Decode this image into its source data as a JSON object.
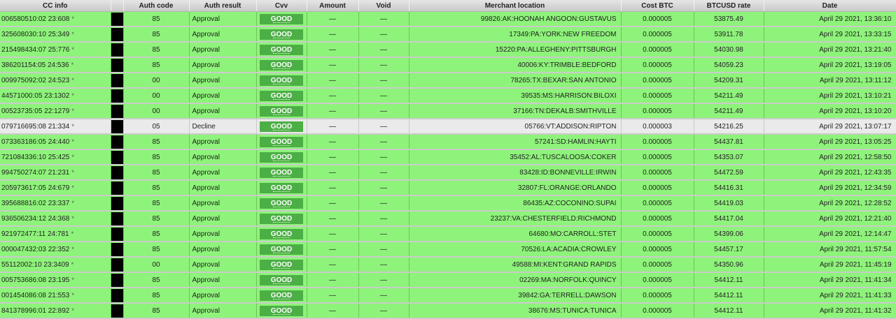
{
  "headers": {
    "cc_info": "CC info",
    "auth_code": "Auth code",
    "auth_result": "Auth result",
    "cvv": "Cvv",
    "amount": "Amount",
    "void": "Void",
    "merchant_location": "Merchant location",
    "cost_btc": "Cost BTC",
    "btcusd_rate": "BTCUSD rate",
    "date": "Date"
  },
  "colors": {
    "approval_row": "#8ef37a",
    "decline_row": "#e9eae9",
    "good_badge": "#4caf45",
    "swatch": "#000000"
  },
  "rows": [
    {
      "cc": "006580510:02 23:608",
      "star": "*",
      "auth_code": "85",
      "auth_result": "Approval",
      "cvv": "GOOD",
      "amount": "—",
      "void": "—",
      "location": "99826:AK:HOONAH ANGOON:GUSTAVUS",
      "cost_btc": "0.000005",
      "rate": "53875.49",
      "date": "April 29 2021, 13:36:10"
    },
    {
      "cc": "325608030:10 25:349",
      "star": "*",
      "auth_code": "85",
      "auth_result": "Approval",
      "cvv": "GOOD",
      "amount": "—",
      "void": "—",
      "location": "17349:PA:YORK:NEW FREEDOM",
      "cost_btc": "0.000005",
      "rate": "53911.78",
      "date": "April 29 2021, 13:33:15"
    },
    {
      "cc": "215498434:07 25:776",
      "star": "*",
      "auth_code": "85",
      "auth_result": "Approval",
      "cvv": "GOOD",
      "amount": "—",
      "void": "—",
      "location": "15220:PA:ALLEGHENY:PITTSBURGH",
      "cost_btc": "0.000005",
      "rate": "54030.98",
      "date": "April 29 2021, 13:21:40"
    },
    {
      "cc": "386201154:05 24:536",
      "star": "*",
      "auth_code": "85",
      "auth_result": "Approval",
      "cvv": "GOOD",
      "amount": "—",
      "void": "—",
      "location": "40006:KY:TRIMBLE:BEDFORD",
      "cost_btc": "0.000005",
      "rate": "54059.23",
      "date": "April 29 2021, 13:19:05"
    },
    {
      "cc": "009975092:02 24:523",
      "star": "*",
      "auth_code": "00",
      "auth_result": "Approval",
      "cvv": "GOOD",
      "amount": "—",
      "void": "—",
      "location": "78265:TX:BEXAR:SAN ANTONIO",
      "cost_btc": "0.000005",
      "rate": "54209.31",
      "date": "April 29 2021, 13:11:12"
    },
    {
      "cc": "44571000:05 23:1302",
      "star": "*",
      "auth_code": "00",
      "auth_result": "Approval",
      "cvv": "GOOD",
      "amount": "—",
      "void": "—",
      "location": "39535:MS:HARRISON:BILOXI",
      "cost_btc": "0.000005",
      "rate": "54211.49",
      "date": "April 29 2021, 13:10:21"
    },
    {
      "cc": "00523735:05 22:1279",
      "star": "*",
      "auth_code": "00",
      "auth_result": "Approval",
      "cvv": "GOOD",
      "amount": "—",
      "void": "—",
      "location": "37166:TN:DEKALB:SMITHVILLE",
      "cost_btc": "0.000005",
      "rate": "54211.49",
      "date": "April 29 2021, 13:10:20"
    },
    {
      "cc": "079716695:08 21:334",
      "star": "*",
      "auth_code": "05",
      "auth_result": "Decline",
      "cvv": "GOOD",
      "amount": "—",
      "void": "—",
      "location": "05766:VT:ADDISON:RIPTON",
      "cost_btc": "0.000003",
      "rate": "54216.25",
      "date": "April 29 2021, 13:07:17"
    },
    {
      "cc": "073363186:05 24:440",
      "star": "*",
      "auth_code": "85",
      "auth_result": "Approval",
      "cvv": "GOOD",
      "amount": "—",
      "void": "—",
      "location": "57241:SD:HAMLIN:HAYTI",
      "cost_btc": "0.000005",
      "rate": "54437.81",
      "date": "April 29 2021, 13:05:25"
    },
    {
      "cc": "721084336:10 25:425",
      "star": "*",
      "auth_code": "85",
      "auth_result": "Approval",
      "cvv": "GOOD",
      "amount": "—",
      "void": "—",
      "location": "35452:AL:TUSCALOOSA:COKER",
      "cost_btc": "0.000005",
      "rate": "54353.07",
      "date": "April 29 2021, 12:58:50"
    },
    {
      "cc": "994750274:07 21:231",
      "star": "*",
      "auth_code": "85",
      "auth_result": "Approval",
      "cvv": "GOOD",
      "amount": "—",
      "void": "—",
      "location": "83428:ID:BONNEVILLE:IRWIN",
      "cost_btc": "0.000005",
      "rate": "54472.59",
      "date": "April 29 2021, 12:43:35"
    },
    {
      "cc": "205973617:05 24:679",
      "star": "*",
      "auth_code": "85",
      "auth_result": "Approval",
      "cvv": "GOOD",
      "amount": "—",
      "void": "—",
      "location": "32807:FL:ORANGE:ORLANDO",
      "cost_btc": "0.000005",
      "rate": "54416.31",
      "date": "April 29 2021, 12:34:59"
    },
    {
      "cc": "395688816:02 23:337",
      "star": "*",
      "auth_code": "85",
      "auth_result": "Approval",
      "cvv": "GOOD",
      "amount": "—",
      "void": "—",
      "location": "86435:AZ:COCONINO:SUPAI",
      "cost_btc": "0.000005",
      "rate": "54419.03",
      "date": "April 29 2021, 12:28:52"
    },
    {
      "cc": "936506234:12 24:368",
      "star": "*",
      "auth_code": "85",
      "auth_result": "Approval",
      "cvv": "GOOD",
      "amount": "—",
      "void": "—",
      "location": "23237:VA:CHESTERFIELD:RICHMOND",
      "cost_btc": "0.000005",
      "rate": "54417.04",
      "date": "April 29 2021, 12:21:40"
    },
    {
      "cc": "921972477:11 24:781",
      "star": "*",
      "auth_code": "85",
      "auth_result": "Approval",
      "cvv": "GOOD",
      "amount": "—",
      "void": "—",
      "location": "64680:MO:CARROLL:STET",
      "cost_btc": "0.000005",
      "rate": "54399.06",
      "date": "April 29 2021, 12:14:47"
    },
    {
      "cc": "000047432:03 22:352",
      "star": "*",
      "auth_code": "85",
      "auth_result": "Approval",
      "cvv": "GOOD",
      "amount": "—",
      "void": "—",
      "location": "70526:LA:ACADIA:CROWLEY",
      "cost_btc": "0.000005",
      "rate": "54457.17",
      "date": "April 29 2021, 11:57:54"
    },
    {
      "cc": "55112002:10 23:3409",
      "star": "*",
      "auth_code": "00",
      "auth_result": "Approval",
      "cvv": "GOOD",
      "amount": "—",
      "void": "—",
      "location": "49588:MI:KENT:GRAND RAPIDS",
      "cost_btc": "0.000005",
      "rate": "54350.96",
      "date": "April 29 2021, 11:45:19"
    },
    {
      "cc": "005753686:08 23:195",
      "star": "*",
      "auth_code": "85",
      "auth_result": "Approval",
      "cvv": "GOOD",
      "amount": "—",
      "void": "—",
      "location": "02269:MA:NORFOLK:QUINCY",
      "cost_btc": "0.000005",
      "rate": "54412.11",
      "date": "April 29 2021, 11:41:34"
    },
    {
      "cc": "001454086:08 21:553",
      "star": "*",
      "auth_code": "85",
      "auth_result": "Approval",
      "cvv": "GOOD",
      "amount": "—",
      "void": "—",
      "location": "39842:GA:TERRELL:DAWSON",
      "cost_btc": "0.000005",
      "rate": "54412.11",
      "date": "April 29 2021, 11:41:33"
    },
    {
      "cc": "841378996:01 22:892",
      "star": "*",
      "auth_code": "85",
      "auth_result": "Approval",
      "cvv": "GOOD",
      "amount": "—",
      "void": "—",
      "location": "38676:MS:TUNICA:TUNICA",
      "cost_btc": "0.000005",
      "rate": "54412.11",
      "date": "April 29 2021, 11:41:32"
    }
  ]
}
